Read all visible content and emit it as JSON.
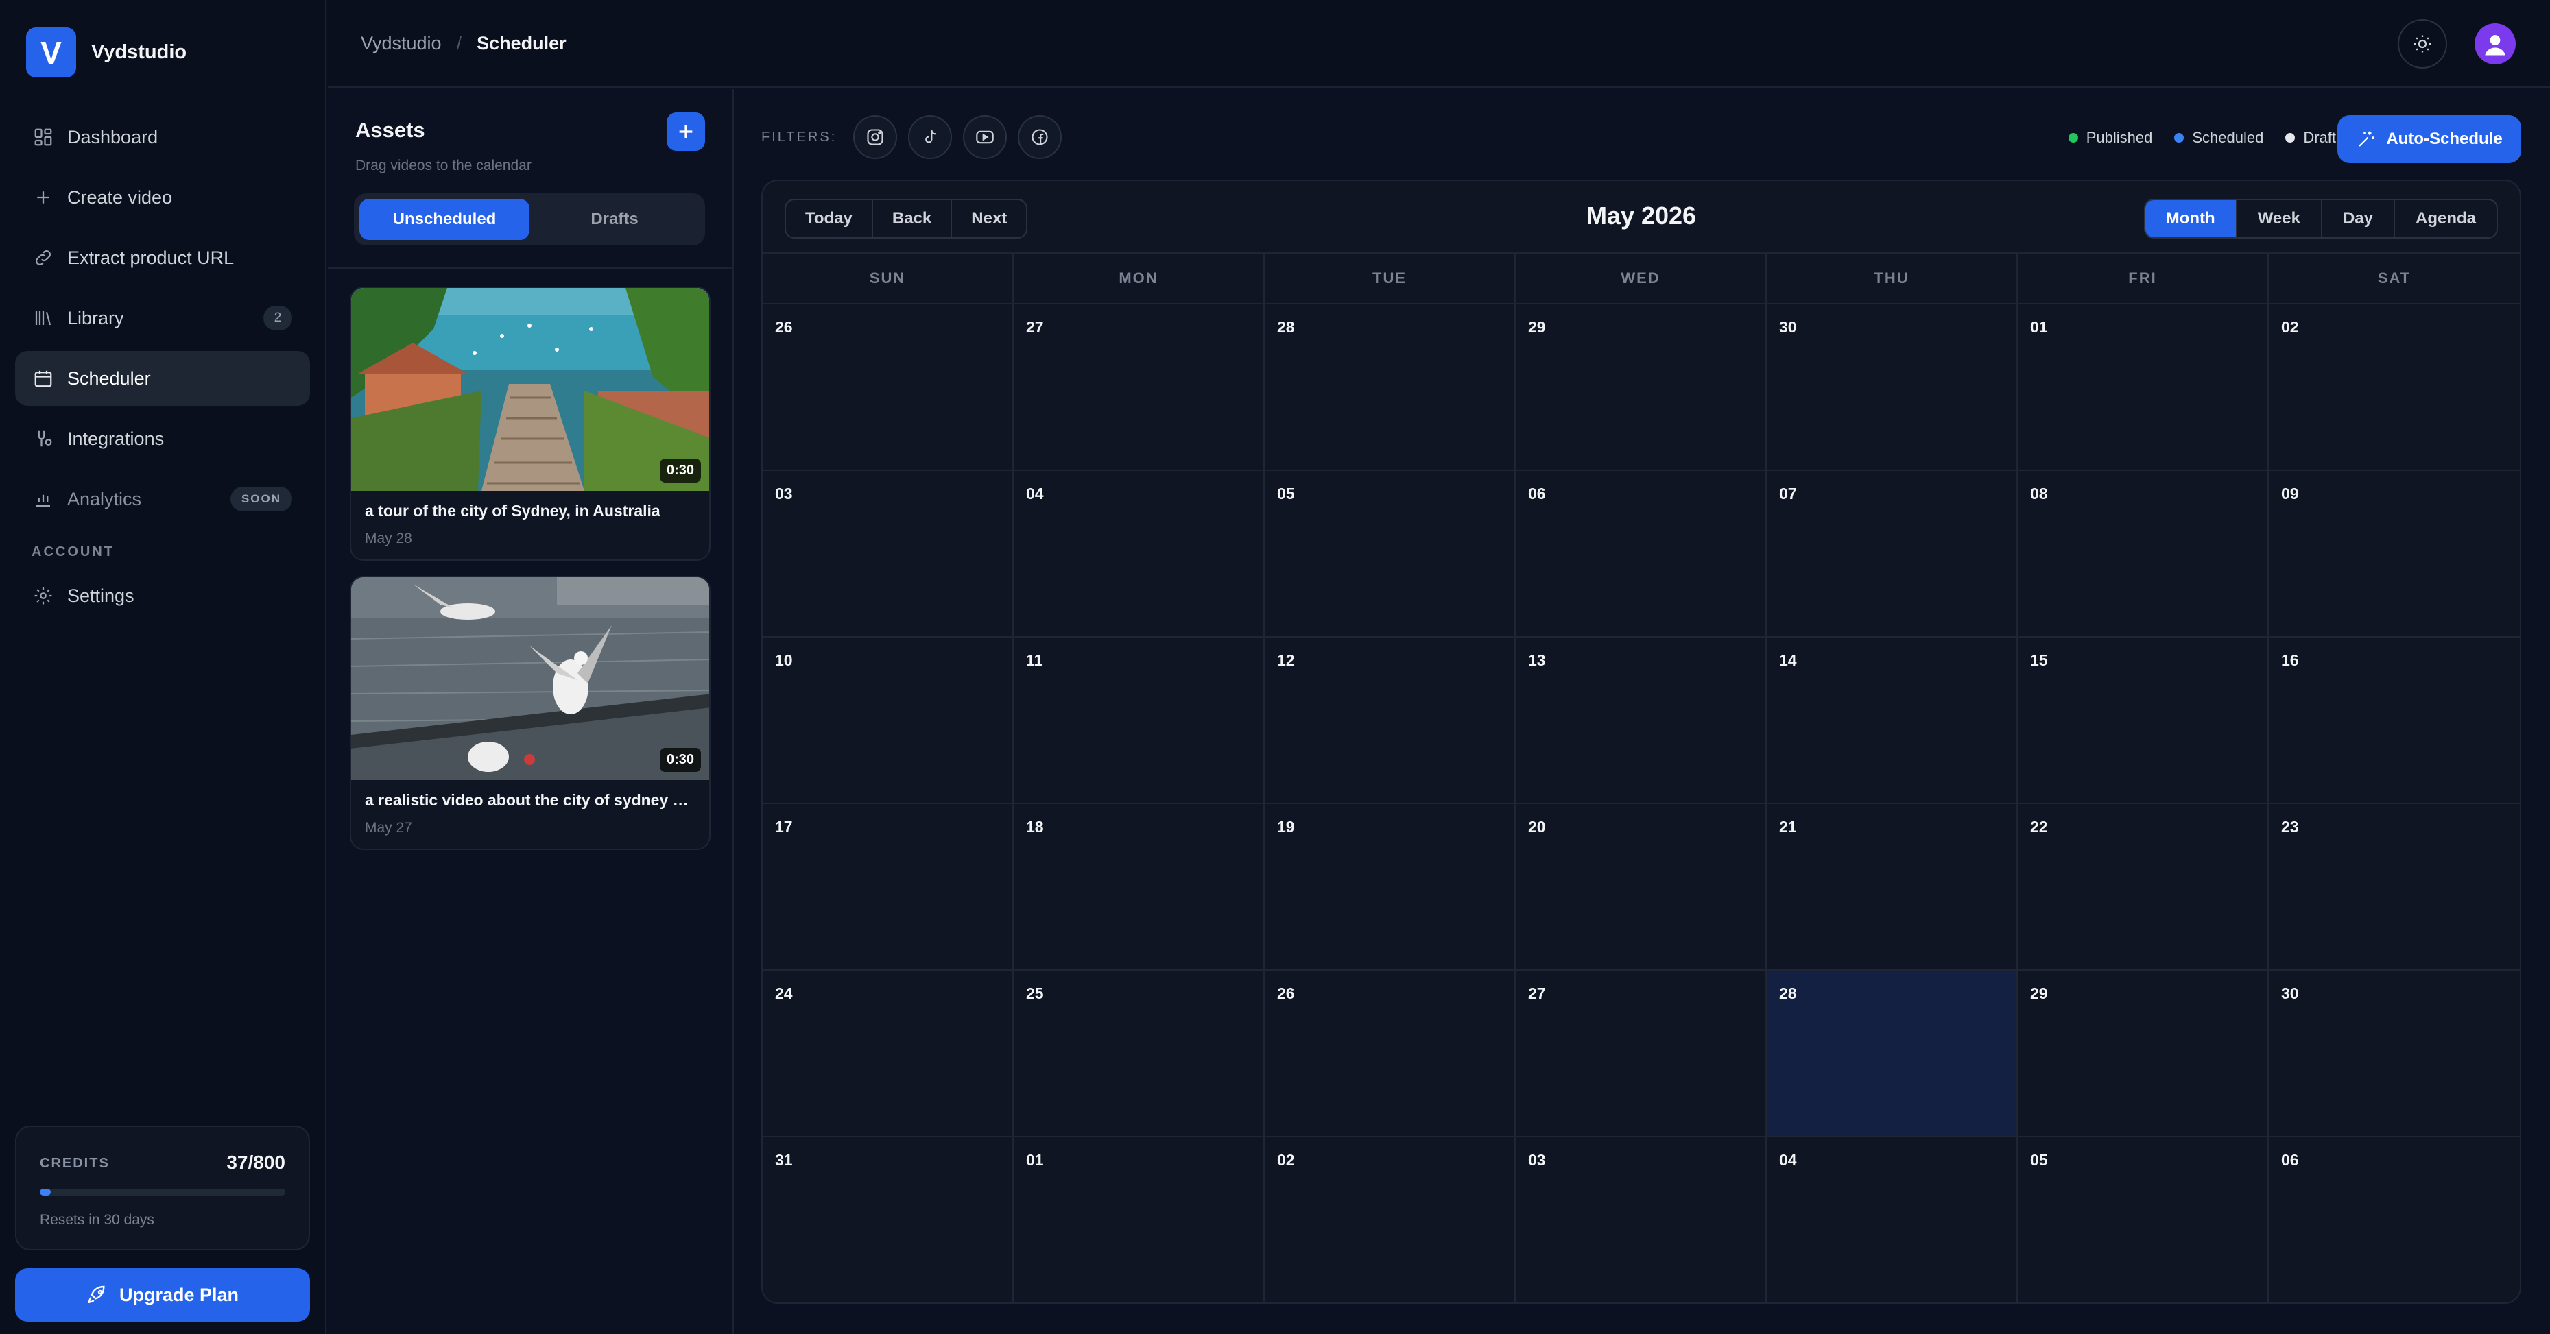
{
  "app": {
    "name": "Vydstudio",
    "logo_letter": "V"
  },
  "sidebar": {
    "items": [
      {
        "label": "Dashboard",
        "icon": "grid-icon"
      },
      {
        "label": "Create video",
        "icon": "plus-icon"
      },
      {
        "label": "Extract product URL",
        "icon": "link-icon"
      },
      {
        "label": "Library",
        "icon": "library-icon",
        "count": "2"
      },
      {
        "label": "Scheduler",
        "icon": "calendar-icon",
        "active": true
      },
      {
        "label": "Integrations",
        "icon": "integrations-icon"
      },
      {
        "label": "Analytics",
        "icon": "bar-chart-icon",
        "badge": "SOON"
      }
    ],
    "account_label": "ACCOUNT",
    "settings_label": "Settings",
    "credits": {
      "label": "CREDITS",
      "value": "37/800",
      "used_fraction": 0.046,
      "note": "Resets in 30 days"
    },
    "upgrade_label": "Upgrade Plan"
  },
  "topbar": {
    "breadcrumb": [
      "Vydstudio",
      "Scheduler"
    ],
    "separator": "/"
  },
  "assets": {
    "title": "Assets",
    "subtitle": "Drag videos to the calendar",
    "tabs": [
      {
        "label": "Unscheduled",
        "active": true
      },
      {
        "label": "Drafts",
        "active": false
      }
    ],
    "videos": [
      {
        "title": "a tour of the city of Sydney, in Australia",
        "date": "May 28",
        "duration": "0:30"
      },
      {
        "title": "a realistic video about the city of sydney au...",
        "date": "May 27",
        "duration": "0:30"
      }
    ]
  },
  "filters": {
    "label": "FILTERS:",
    "platforms": [
      "instagram-icon",
      "tiktok-icon",
      "youtube-icon",
      "facebook-icon"
    ]
  },
  "legend": [
    {
      "label": "Published",
      "color": "#22c55e"
    },
    {
      "label": "Scheduled",
      "color": "#3b82f6"
    },
    {
      "label": "Draft",
      "color": "#e5e7eb"
    }
  ],
  "auto_schedule_label": "Auto-Schedule",
  "calendar": {
    "nav": [
      "Today",
      "Back",
      "Next"
    ],
    "title": "May 2026",
    "views": [
      {
        "label": "Month",
        "active": true
      },
      {
        "label": "Week",
        "active": false
      },
      {
        "label": "Day",
        "active": false
      },
      {
        "label": "Agenda",
        "active": false
      }
    ],
    "weekdays": [
      "SUN",
      "MON",
      "TUE",
      "WED",
      "THU",
      "FRI",
      "SAT"
    ],
    "days": [
      "26",
      "27",
      "28",
      "29",
      "30",
      "01",
      "02",
      "03",
      "04",
      "05",
      "06",
      "07",
      "08",
      "09",
      "10",
      "11",
      "12",
      "13",
      "14",
      "15",
      "16",
      "17",
      "18",
      "19",
      "20",
      "21",
      "22",
      "23",
      "24",
      "25",
      "26",
      "27",
      "28",
      "29",
      "30",
      "31",
      "01",
      "02",
      "03",
      "04",
      "05",
      "06"
    ],
    "today_index": 32
  },
  "colors": {
    "accent": "#2563eb",
    "background": "#0b1120",
    "today_cell": "#142042"
  }
}
